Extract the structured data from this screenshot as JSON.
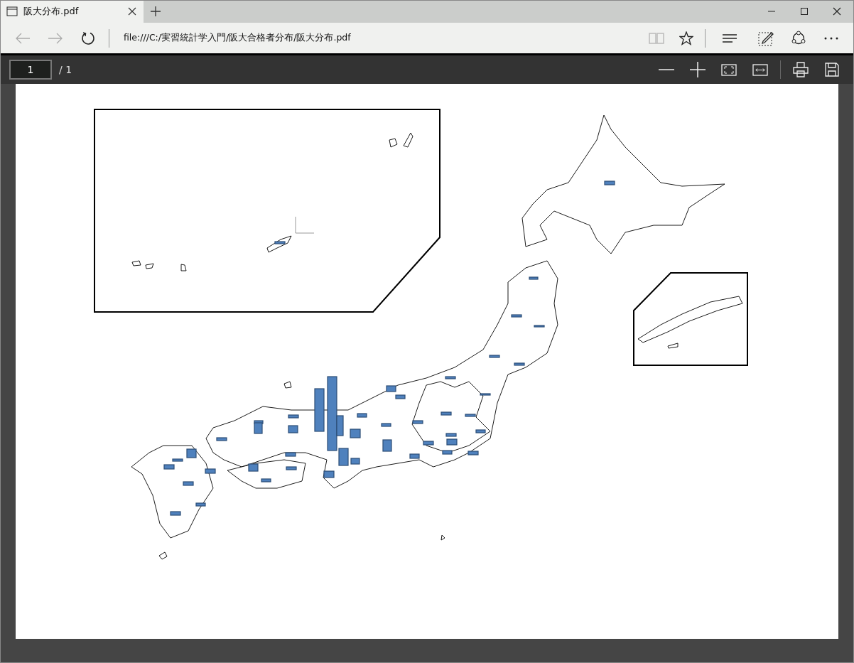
{
  "tab": {
    "title": "阪大分布.pdf"
  },
  "address_bar": {
    "value": "file:///C:/実習統計学入門/阪大合格者分布/阪大分布.pdf"
  },
  "pdf_toolbar": {
    "page": "1",
    "page_total": "/ 1"
  }
}
